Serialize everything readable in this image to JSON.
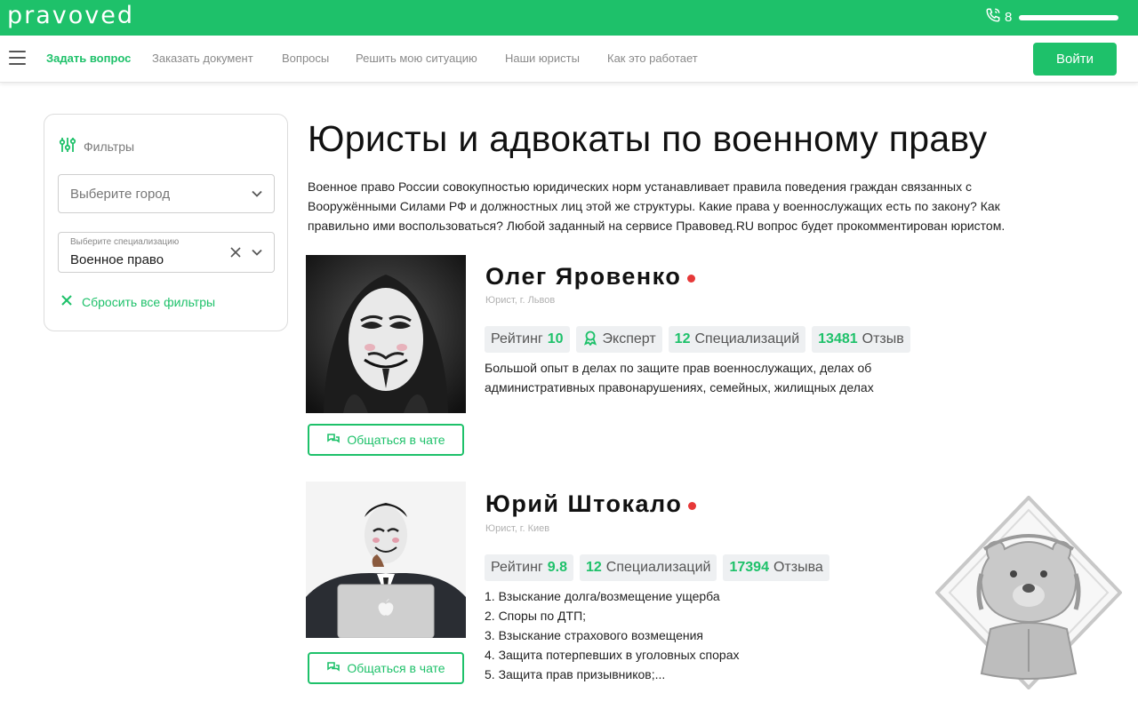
{
  "header": {
    "logo": "pravoved",
    "phone_prefix": "8",
    "colors": {
      "brand": "#1ec16a",
      "online": "#e63838"
    }
  },
  "nav": {
    "items": [
      {
        "label": "Задать вопрос",
        "active": true
      },
      {
        "label": "Заказать документ"
      },
      {
        "label": "Вопросы"
      },
      {
        "label": "Решить мою ситуацию"
      },
      {
        "label": "Наши юристы"
      },
      {
        "label": "Как это работает"
      }
    ],
    "login_label": "Войти"
  },
  "filters": {
    "title": "Фильтры",
    "city_placeholder": "Выберите город",
    "spec_label": "Выберите специализацию",
    "spec_value": "Военное право",
    "reset_label": "Сбросить все фильтры"
  },
  "main": {
    "title": "Юристы и адвокаты по военному праву",
    "intro": "Военное право России совокупностью юридических норм устанавливает правила поведения граждан связанных с Вооружёнными Силами РФ и должностных лиц этой же структуры. Какие права у военнослужащих есть по закону? Как правильно ими воспользоваться? Любой заданный на сервисе Правовед.RU вопрос будет прокомментирован юристом."
  },
  "lawyers": [
    {
      "name": "Олег Яровенко",
      "subtitle": "Юрист, г. Львов",
      "rating_label": "Рейтинг",
      "rating": "10",
      "expert_label": "Эксперт",
      "spec_count": "12",
      "spec_label": "Специализаций",
      "reviews_count": "13481",
      "reviews_label": "Отзыв",
      "description": "Большой опыт в делах по защите прав военнослужащих, делах об административных правонарушениях, семейных, жилищных делах",
      "chat_label": "Общаться в чате"
    },
    {
      "name": "Юрий Штокало",
      "subtitle": "Юрист, г. Киев",
      "rating_label": "Рейтинг",
      "rating": "9.8",
      "spec_count": "12",
      "spec_label": "Специализаций",
      "reviews_count": "17394",
      "reviews_label": "Отзыва",
      "list": [
        "1. Взыскание долга/возмещение ущерба",
        "2. Споры по ДТП;",
        "3. Взыскание страхового возмещения",
        "4. Защита потерпевших в уголовных спорах",
        "5. Защита прав призывников;..."
      ],
      "chat_label": "Общаться в чате"
    }
  ]
}
